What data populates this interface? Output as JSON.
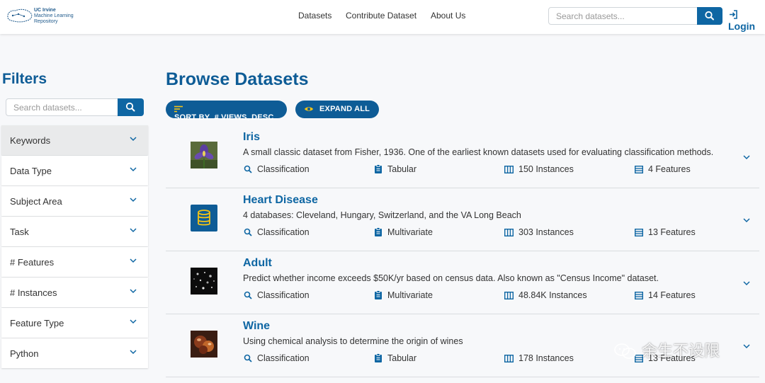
{
  "header": {
    "logo_lines": [
      "UC Irvine",
      "Machine Learning",
      "Repository"
    ],
    "nav": [
      "Datasets",
      "Contribute Dataset",
      "About Us"
    ],
    "search_placeholder": "Search datasets...",
    "login_label": "Login"
  },
  "sidebar": {
    "title": "Filters",
    "search_placeholder": "Search datasets...",
    "filters": [
      "Keywords",
      "Data Type",
      "Subject Area",
      "Task",
      "# Features",
      "# Instances",
      "Feature Type",
      "Python"
    ]
  },
  "main": {
    "title": "Browse Datasets",
    "sort_label": "SORT BY  # VIEWS, DESC",
    "expand_label": "EXPAND ALL",
    "datasets": [
      {
        "name": "Iris",
        "description": "A small classic dataset from Fisher, 1936. One of the earliest known datasets used for evaluating classification methods.",
        "task": "Classification",
        "data_type": "Tabular",
        "instances": "150 Instances",
        "features": "4 Features",
        "thumb": "iris-flower"
      },
      {
        "name": "Heart Disease",
        "description": "4 databases: Cleveland, Hungary, Switzerland, and the VA Long Beach",
        "task": "Classification",
        "data_type": "Multivariate",
        "instances": "303 Instances",
        "features": "13 Features",
        "thumb": "database-icon"
      },
      {
        "name": "Adult",
        "description": "Predict whether income exceeds $50K/yr based on census data. Also known as \"Census Income\" dataset.",
        "task": "Classification",
        "data_type": "Multivariate",
        "instances": "48.84K Instances",
        "features": "14 Features",
        "thumb": "dark-dots"
      },
      {
        "name": "Wine",
        "description": "Using chemical analysis to determine the origin of wines",
        "task": "Classification",
        "data_type": "Tabular",
        "instances": "178 Instances",
        "features": "13 Features",
        "thumb": "wine-glass"
      }
    ]
  },
  "watermark": "余生不设限",
  "colors": {
    "brand": "#0e5c96",
    "link": "#0e66a3",
    "bg": "#f7f8fa"
  }
}
